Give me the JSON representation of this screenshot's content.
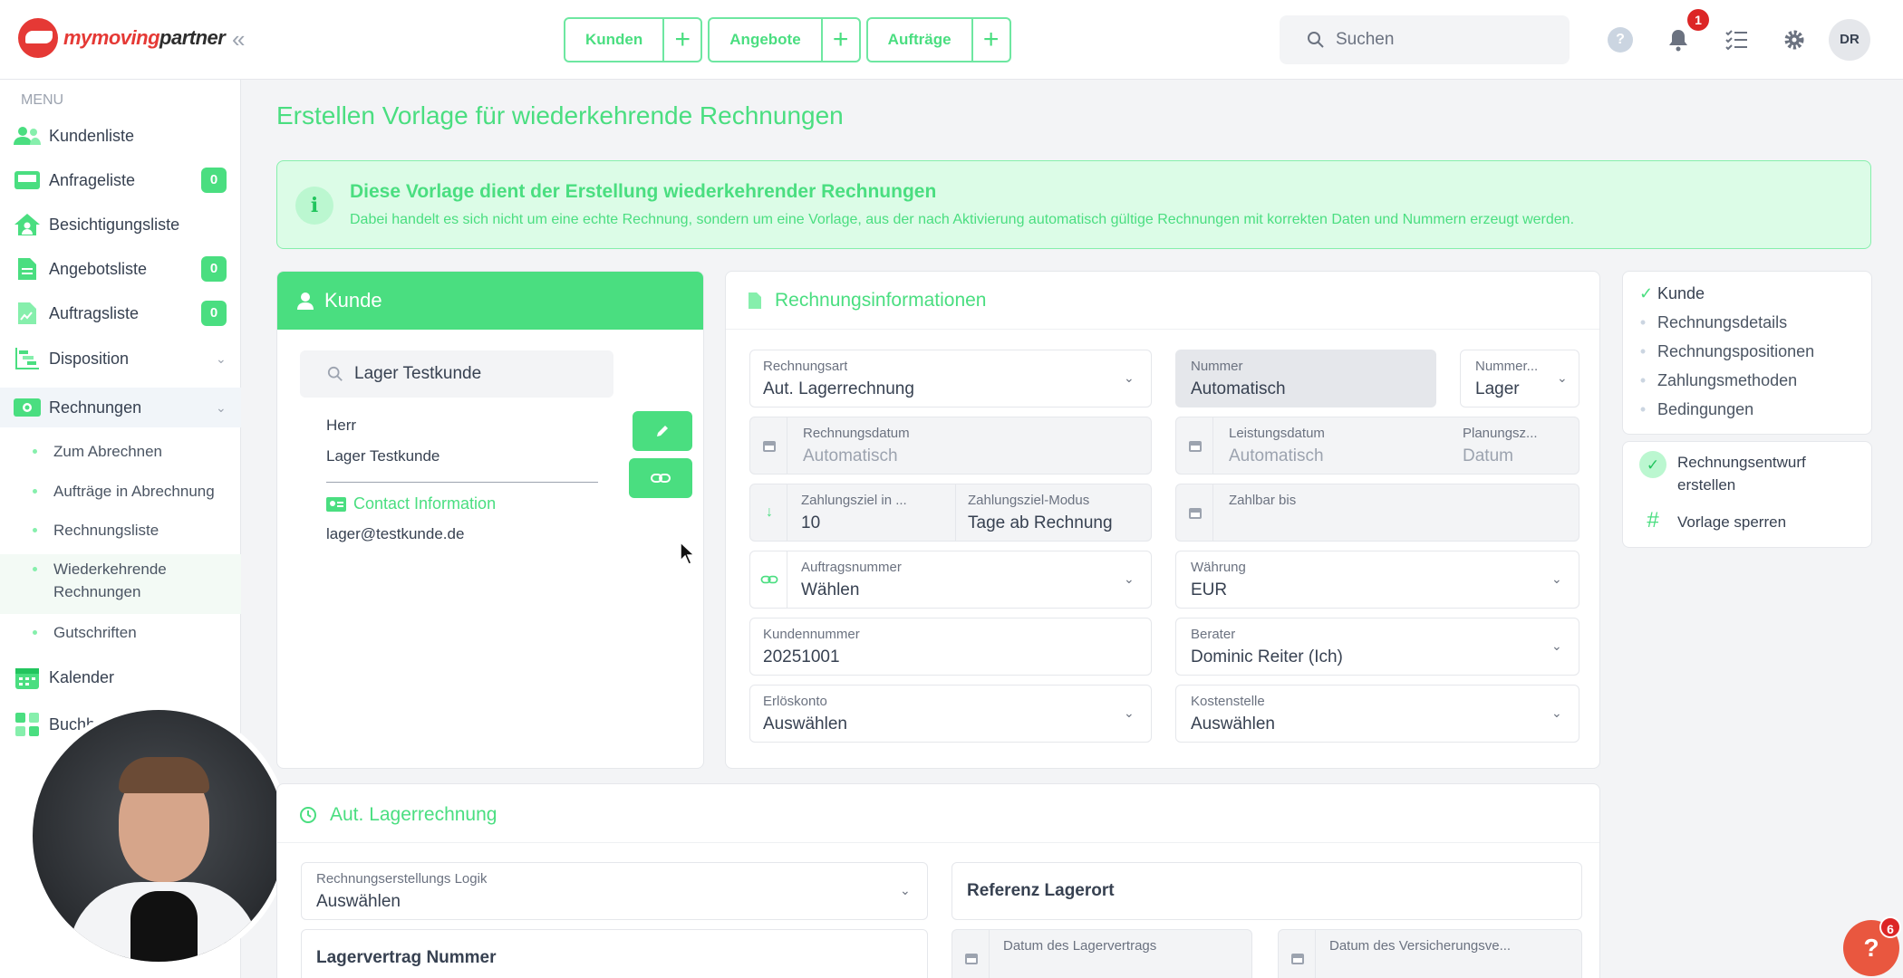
{
  "brand": {
    "name_part1": "mymoving",
    "name_part2": "partner"
  },
  "topbar": {
    "quick_buttons": [
      {
        "label": "Kunden"
      },
      {
        "label": "Angebote"
      },
      {
        "label": "Aufträge"
      }
    ],
    "search_placeholder": "Suchen",
    "notification_count": "1",
    "user_initials": "DR"
  },
  "sidebar": {
    "menu_heading": "MENU",
    "items": [
      {
        "label": "Kundenliste"
      },
      {
        "label": "Anfrageliste",
        "count": "0"
      },
      {
        "label": "Besichtigungsliste"
      },
      {
        "label": "Angebotsliste",
        "count": "0"
      },
      {
        "label": "Auftragsliste",
        "count": "0"
      },
      {
        "label": "Disposition"
      },
      {
        "label": "Rechnungen"
      },
      {
        "label": "Kalender"
      },
      {
        "label": "Buchh"
      }
    ],
    "sub_items": [
      {
        "label": "Zum Abrechnen"
      },
      {
        "label": "Aufträge in Abrechnung"
      },
      {
        "label": "Rechnungsliste"
      },
      {
        "label": "Wiederkehrende Rechnungen"
      },
      {
        "label": "Gutschriften"
      }
    ]
  },
  "page": {
    "title": "Erstellen Vorlage für wiederkehrende Rechnungen",
    "info_title": "Diese Vorlage dient der Erstellung wiederkehrender Rechnungen",
    "info_text": "Dabei handelt es sich nicht um eine echte Rechnung, sondern um eine Vorlage, aus der nach Aktivierung automatisch gültige Rechnungen mit korrekten Daten und Nummern erzeugt werden."
  },
  "kunde": {
    "heading": "Kunde",
    "search_value": "Lager Testkunde",
    "salutation": "Herr",
    "name": "Lager Testkunde",
    "contact_heading": "Contact Information",
    "email": "lager@testkunde.de"
  },
  "rechnung": {
    "heading": "Rechnungsinformationen",
    "rechnungsart": {
      "label": "Rechnungsart",
      "value": "Aut. Lagerrechnung"
    },
    "nummer": {
      "label": "Nummer",
      "value": "Automatisch"
    },
    "nummernkreis": {
      "label": "Nummer...",
      "value": "Lager"
    },
    "rechnungsdatum": {
      "label": "Rechnungsdatum",
      "value": "Automatisch"
    },
    "leistungsdatum": {
      "label": "Leistungsdatum",
      "value": "Automatisch"
    },
    "planungszeitraum": {
      "label": "Planungsz...",
      "value": "Datum"
    },
    "zahlungsziel": {
      "label": "Zahlungsziel in ...",
      "value": "10"
    },
    "zahlungsziel_modus": {
      "label": "Zahlungsziel-Modus",
      "value": "Tage ab Rechnung"
    },
    "zahlbar_bis": {
      "label": "Zahlbar bis",
      "value": ""
    },
    "auftragsnummer": {
      "label": "Auftragsnummer",
      "value": "Wählen"
    },
    "waehrung": {
      "label": "Währung",
      "value": "EUR"
    },
    "kundennummer": {
      "label": "Kundennummer",
      "value": "20251001"
    },
    "berater": {
      "label": "Berater",
      "value": "Dominic Reiter (Ich)"
    },
    "erloeskonto": {
      "label": "Erlöskonto",
      "value": "Auswählen"
    },
    "kostenstelle": {
      "label": "Kostenstelle",
      "value": "Auswählen"
    }
  },
  "steps": [
    {
      "label": "Kunde",
      "done": true
    },
    {
      "label": "Rechnungsdetails",
      "done": false
    },
    {
      "label": "Rechnungspositionen",
      "done": false
    },
    {
      "label": "Zahlungsmethoden",
      "done": false
    },
    {
      "label": "Bedingungen",
      "done": false
    }
  ],
  "actions": {
    "create_draft": "Rechnungsentwurf erstellen",
    "lock_template": "Vorlage sperren"
  },
  "lager": {
    "heading": "Aut. Lagerrechnung",
    "logik": {
      "label": "Rechnungserstellungs Logik",
      "value": "Auswählen"
    },
    "referenz": {
      "label": "Referenz Lagerort"
    },
    "vertragsnummer": {
      "label": "Lagervertrag Nummer"
    },
    "vertragsdatum": {
      "label": "Datum des Lagervertrags"
    },
    "versicherung": {
      "label": "Datum des Versicherungsve..."
    }
  },
  "help_badge": "6",
  "icons": [
    "search-icon",
    "help-icon",
    "bell-icon",
    "tasks-icon",
    "gear-icon",
    "user-icon",
    "pencil-icon",
    "link-icon",
    "calendar-icon",
    "chevron-down-icon",
    "check-icon"
  ],
  "colors": {
    "accent": "#4ade80",
    "info_bg": "#dcfce7",
    "alert": "#dc2626"
  }
}
